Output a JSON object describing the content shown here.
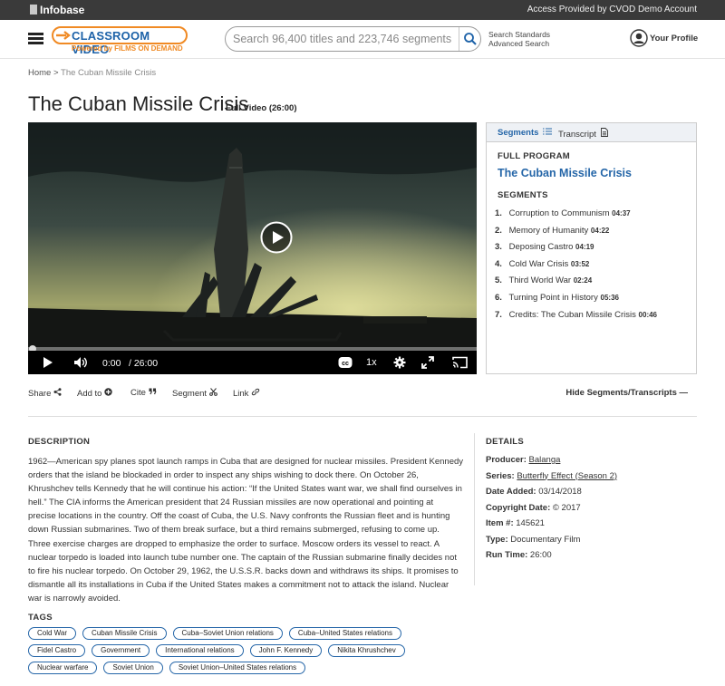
{
  "topbar": {
    "brand": "Infobase",
    "access_text": "Access Provided by CVOD Demo Account"
  },
  "header": {
    "logo_title": "CLASSROOM VIDEO",
    "logo_powered": "Powered by FILMS ON DEMAND",
    "search_placeholder": "Search 96,400 titles and 223,746 segments",
    "search_standards": "Search Standards",
    "advanced_search": "Advanced Search",
    "profile_label": "Your Profile"
  },
  "breadcrumb": {
    "home": "Home",
    "separator": ">",
    "current": "The Cuban Missile Crisis"
  },
  "video": {
    "title": "The Cuban Missile Crisis",
    "full_video_label": "Full Video (26:00)",
    "current_time": "0:00",
    "duration": "/ 26:00",
    "speed": "1x",
    "progress_fraction": 0.0
  },
  "panel": {
    "tab_segments": "Segments",
    "tab_transcript": "Transcript",
    "full_program_label": "FULL PROGRAM",
    "full_program_title": "The Cuban Missile Crisis",
    "segments_label": "SEGMENTS",
    "segments": [
      {
        "num": "1.",
        "title": "Corruption to Communism",
        "dur": "04:37"
      },
      {
        "num": "2.",
        "title": "Memory of Humanity",
        "dur": "04:22"
      },
      {
        "num": "3.",
        "title": "Deposing Castro",
        "dur": "04:19"
      },
      {
        "num": "4.",
        "title": "Cold War Crisis",
        "dur": "03:52"
      },
      {
        "num": "5.",
        "title": "Third World War",
        "dur": "02:24"
      },
      {
        "num": "6.",
        "title": "Turning Point in History",
        "dur": "05:36"
      },
      {
        "num": "7.",
        "title": "Credits: The Cuban Missile Crisis",
        "dur": "00:46"
      }
    ]
  },
  "actions": {
    "share": "Share",
    "add_to": "Add to",
    "cite": "Cite",
    "segment": "Segment",
    "link": "Link",
    "hide": "Hide Segments/Transcripts"
  },
  "description": {
    "heading": "DESCRIPTION",
    "text": "1962—American spy planes spot launch ramps in Cuba that are designed for nuclear missiles. President Kennedy orders that the island be blockaded in order to inspect any ships wishing to dock there. On October 26, Khrushchev tells Kennedy that he will continue his action: “If the United States want war, we shall find ourselves in hell.” The CIA informs the American president that 24 Russian missiles are now operational and pointing at precise locations in the country. Off the coast of Cuba, the U.S. Navy confronts the Russian fleet and is hunting down Russian submarines. Two of them break surface, but a third remains submerged, refusing to come up. Three exercise charges are dropped to emphasize the order to surface. Moscow orders its vessel to react. A nuclear torpedo is loaded into launch tube number one. The captain of the Russian submarine finally decides not to fire his nuclear torpedo. On October 29, 1962, the U.S.S.R. backs down and withdraws its ships. It promises to dismantle all its installations in Cuba if the United States makes a commitment not to attack the island. Nuclear war is narrowly avoided."
  },
  "details": {
    "heading": "DETAILS",
    "producer_k": "Producer:",
    "producer_v": "Balanga",
    "series_k": "Series:",
    "series_v": "Butterfly Effect (Season 2)",
    "date_k": "Date Added:",
    "date_v": "03/14/2018",
    "copyright_k": "Copyright Date:",
    "copyright_v": "© 2017",
    "item_k": "Item #:",
    "item_v": "145621",
    "type_k": "Type:",
    "type_v": "Documentary Film",
    "runtime_k": "Run Time:",
    "runtime_v": "26:00"
  },
  "tags": {
    "heading": "TAGS",
    "rows": [
      [
        "Cold War",
        "Cuban Missile Crisis",
        "Cuba–Soviet Union relations",
        "Cuba–United States relations"
      ],
      [
        "Fidel Castro",
        "Government",
        "International relations",
        "John F. Kennedy",
        "Nikita Khrushchev"
      ],
      [
        "Nuclear warfare",
        "Soviet Union",
        "Soviet Union–United States relations"
      ]
    ]
  },
  "colors": {
    "accent_blue": "#2566a8",
    "logo_orange": "#f08a24",
    "topbar": "#3a3a3a"
  }
}
